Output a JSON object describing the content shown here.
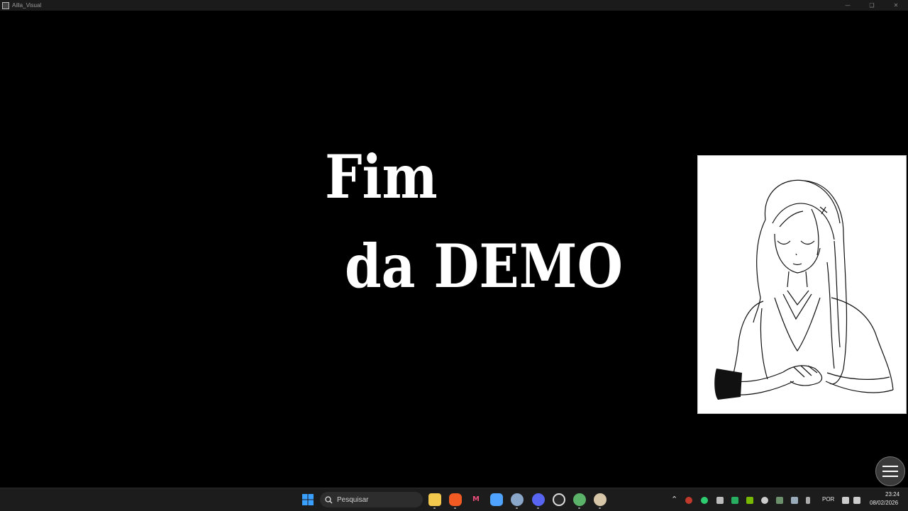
{
  "window": {
    "title": "Ailla_Visual",
    "controls": [
      "minimize-icon",
      "maximize-icon",
      "close-icon"
    ]
  },
  "game": {
    "line1": "Fim",
    "line2": "da DEMO",
    "portrait": "line-art girl with long hair, eyes closed, smiling, hands folded",
    "menu_icon": "hamburger-menu-icon"
  },
  "taskbar": {
    "start_icon": "windows-start-icon",
    "search_placeholder": "Pesquisar",
    "search_icon": "search-icon",
    "pinned": [
      "file-explorer-icon",
      "brave-browser-icon",
      "app-icon",
      "app-icon",
      "settings-icon",
      "discord-icon",
      "app-icon",
      "app-icon",
      "app-icon"
    ],
    "tray": {
      "language": "POR",
      "time": "23:24",
      "date": "08/02/2026"
    }
  }
}
